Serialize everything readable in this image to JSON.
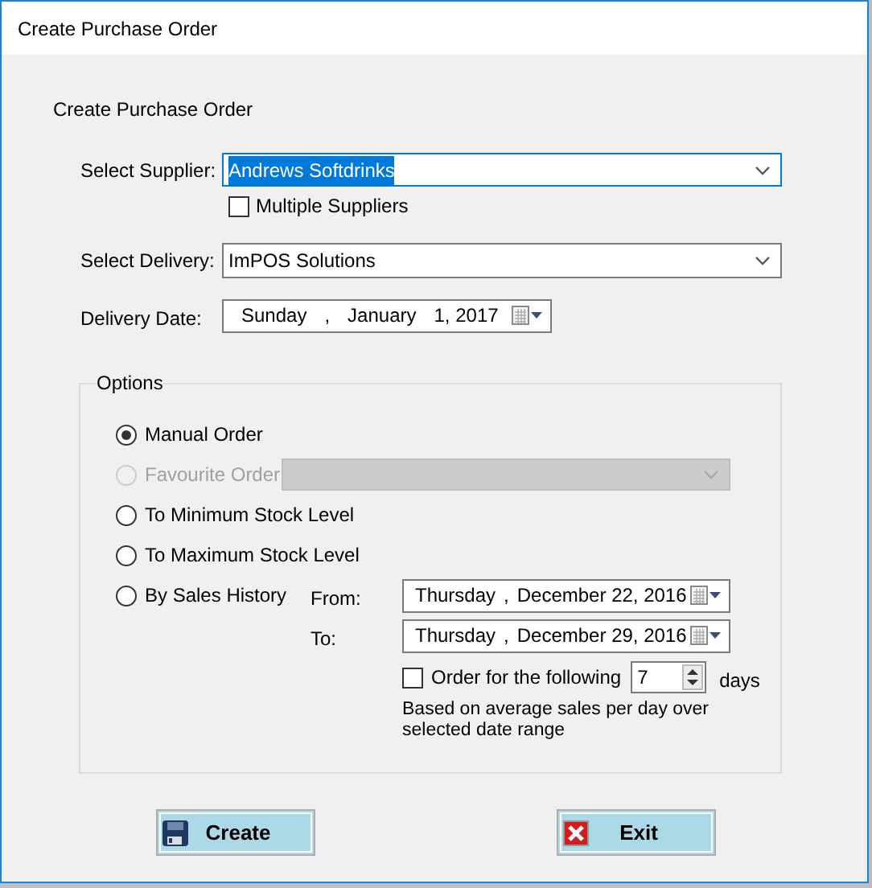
{
  "window": {
    "title": "Create Purchase Order"
  },
  "heading": "Create Purchase Order",
  "supplier": {
    "label": "Select Supplier:",
    "value": "Andrews Softdrinks",
    "focused": true
  },
  "multiple_suppliers": {
    "label": "Multiple Suppliers",
    "checked": false
  },
  "delivery": {
    "label": "Select Delivery:",
    "value": "ImPOS Solutions"
  },
  "delivery_date": {
    "label": "Delivery Date:",
    "parts": [
      "Sunday",
      ",",
      "January",
      "1, 2017"
    ]
  },
  "options": {
    "title": "Options",
    "items": [
      {
        "label": "Manual Order",
        "selected": true,
        "disabled": false
      },
      {
        "label": "Favourite Order",
        "selected": false,
        "disabled": true
      },
      {
        "label": "To Minimum Stock Level",
        "selected": false,
        "disabled": false
      },
      {
        "label": "To Maximum Stock Level",
        "selected": false,
        "disabled": false
      },
      {
        "label": "By Sales History",
        "selected": false,
        "disabled": false
      }
    ],
    "favourite_dropdown": {
      "disabled": true
    },
    "sales_history": {
      "from": {
        "label": "From:",
        "parts": [
          "Thursday",
          ",",
          "December 22, 2016"
        ]
      },
      "to": {
        "label": "To:",
        "parts": [
          "Thursday",
          ",",
          "December 29, 2016"
        ]
      },
      "order_for": {
        "label": "Order for the following",
        "checked": false,
        "value": "7",
        "unit": "days"
      },
      "note": "Based on average sales per day over selected date range"
    }
  },
  "buttons": [
    {
      "label": "Create",
      "kind": "save"
    },
    {
      "label": "Exit",
      "kind": "close"
    }
  ]
}
